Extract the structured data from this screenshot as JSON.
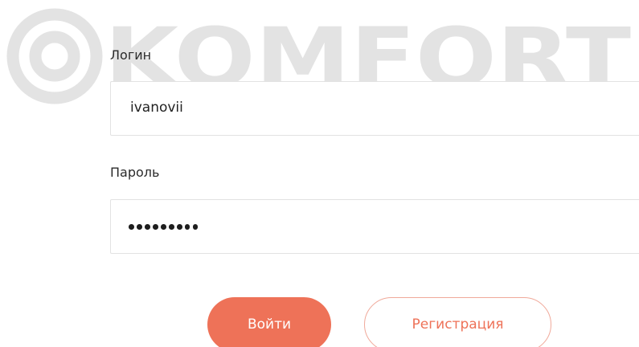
{
  "watermark": {
    "text": "KOMFORT"
  },
  "form": {
    "login_label": "Логин",
    "login_value": "ivanovii",
    "password_label": "Пароль",
    "password_mask": "•••••••••"
  },
  "buttons": {
    "login_label": "Войти",
    "register_label": "Регистрация"
  },
  "colors": {
    "accent": "#ee7258",
    "watermark": "#e3e3e3",
    "border": "#e2e2e2"
  }
}
